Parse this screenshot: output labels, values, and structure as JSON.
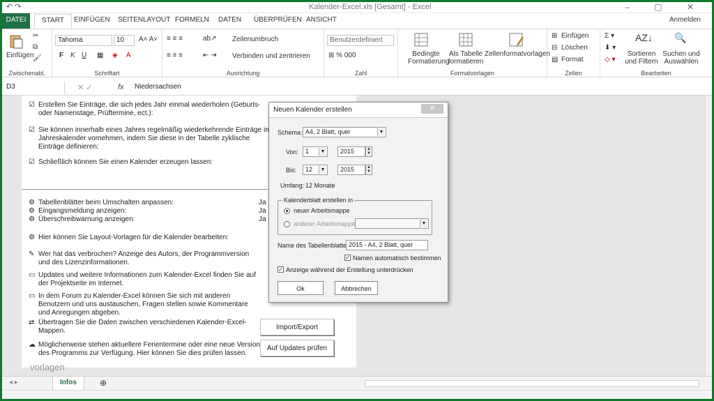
{
  "window": {
    "title": "Kalender-Excel.xls [Gesamt] - Excel"
  },
  "tabs": [
    "DATEI",
    "START",
    "EINFÜGEN",
    "SEITENLAYOUT",
    "FORMELN",
    "DATEN",
    "ÜBERPRÜFEN",
    "ANSICHT"
  ],
  "signin": "Anmelden",
  "ribbon": {
    "clipboard": {
      "paste": "Einfügen",
      "label": "Zwischenabl."
    },
    "font": {
      "name": "Tahoma",
      "size": "10",
      "bold": "F",
      "italic": "K",
      "underline": "U",
      "label": "Schriftart"
    },
    "alignment": {
      "wrap": "Zeilenumbruch",
      "merge": "Verbinden und zentrieren",
      "label": "Ausrichtung"
    },
    "number": {
      "format": "Benutzerdefiniert",
      "label": "Zahl"
    },
    "styles": {
      "conditional": "Bedingte Formatierung",
      "as_table": "Als Tabelle formatieren",
      "cell_styles": "Zellenformatvorlagen",
      "label": "Formatvorlagen"
    },
    "cells": {
      "insert": "Einfügen",
      "delete": "Löschen",
      "format": "Format",
      "label": "Zellen"
    },
    "editing": {
      "sort": "Sortieren und Filtern",
      "find": "Suchen und Auswählen",
      "label": "Bearbeiten"
    }
  },
  "formula_bar": {
    "name_box": "D3",
    "fx": "fx",
    "value": "Niedersachsen"
  },
  "sheet": {
    "rows": [
      {
        "icon": "☑",
        "text": "Erstellen Sie Einträge, die sich jedes Jahr einmal wiederholen (Geburts- oder Namenstage, Prüftermine, ect.):"
      },
      {
        "icon": "☑",
        "text": "Sie können innerhalb eines Jahres regelmäßig wiederkehrende Einträge im Jahreskalender vornehmen, indem Sie diese in der Tabelle zyklische Einträge definieren:"
      },
      {
        "icon": "☑",
        "text": "Schließlich können Sie einen Kalender erzeugen lassen:"
      },
      {
        "icon": "⚙",
        "text": "Tabellenblätter beim Umschalten anpassen:"
      },
      {
        "icon": "⚙",
        "text": "Eingangsmeldung anzeigen:"
      },
      {
        "icon": "⚙",
        "text": "Überschreibwarnung anzeigen:"
      },
      {
        "icon": "⚙",
        "text": "Hier können Sie Layout-Vorlagen für die Kalender bearbeiten:"
      },
      {
        "icon": "✎",
        "text": "Wer hat das verbrochen? Anzeige des Autors, der Programmversion und des Lizenzinformationen."
      },
      {
        "icon": "▭",
        "text": "Updates und weitere Informationen zum Kalender-Excel finden Sie auf der Projektseite im Internet."
      },
      {
        "icon": "▭",
        "text": "In dem Forum zu Kalender-Excel können Sie sich mit anderen Benutzern und uns austauschen, Fragen stellen sowie Kommentare und Anregungen abgeben."
      },
      {
        "icon": "⇄",
        "text": "Übertragen Sie die Daten zwischen verschiedenen Kalender-Excel-Mappen."
      },
      {
        "icon": "☁",
        "text": "Möglicherweise stehen aktuellere Ferientermine oder eine neue Version des Programms zur Verfügung. Hier können Sie dies prüfen lassen."
      }
    ],
    "ja_values": [
      "Ja",
      "Ja",
      "Ja"
    ],
    "buttons": {
      "import_export": "Import/Export",
      "updates": "Auf Updates prüfen"
    },
    "watermark": "vorlagen"
  },
  "dialog": {
    "title": "Neuen Kalender erstellen",
    "close": "✕",
    "schema_label": "Schema:",
    "schema_value": "A4, 2 Blatt, quer",
    "from_label": "Von:",
    "from_month": "1",
    "from_year": "2015",
    "to_label": "Bis:",
    "to_month": "12",
    "to_year": "2015",
    "range_label": "Umfang:",
    "range_value": "12 Monate",
    "group_label": "Kalenderblatt erstellen in",
    "radio_new": "neuer Arbeitsmappe",
    "radio_other": "anderer Arbeitsmappe:",
    "sheetname_label": "Name des Tabellenblattes:",
    "sheetname_value": "2015 - A4, 2 Blatt, quer",
    "auto_name": "Namen automatisch bestimmen",
    "show_progress": "Anzeige während der Erstellung unterdrücken",
    "ok": "Ok",
    "cancel": "Abbrechen"
  },
  "sheet_tabs": {
    "active": "Infos"
  }
}
